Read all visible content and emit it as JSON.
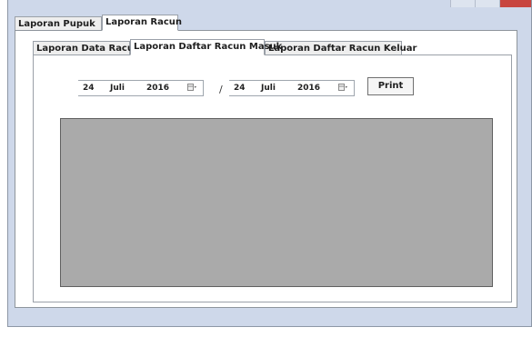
{
  "tabs": {
    "outer": [
      "Laporan Pupuk",
      "Laporan Racun"
    ],
    "inner": [
      "Laporan Data Racun",
      "Laporan Daftar Racun Masuk",
      "Laporan Daftar Racun Keluar"
    ]
  },
  "date_from": {
    "day": "24",
    "month": "Juli",
    "year": "2016"
  },
  "separator": "/",
  "date_to": {
    "day": "24",
    "month": "Juli",
    "year": "2016"
  },
  "print_button": "Print",
  "icons": {
    "calendar": "calendar-dropdown-icon"
  },
  "colors": {
    "window_bg": "#ced8ea",
    "report_bg": "#aaaaaa",
    "close": "#c8453f"
  }
}
